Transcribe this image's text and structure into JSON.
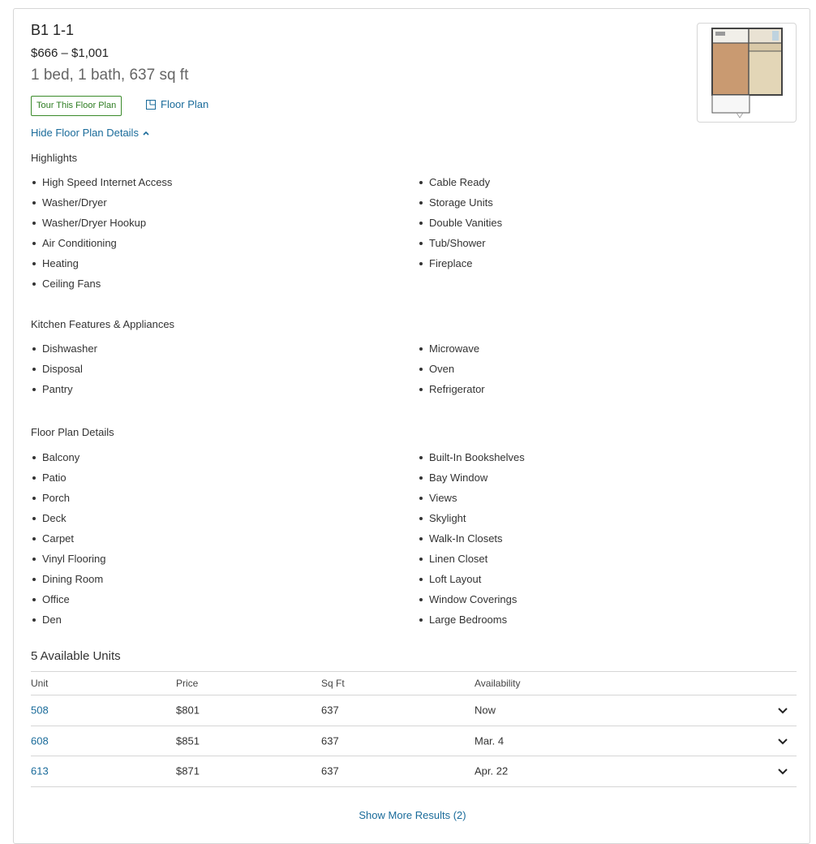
{
  "plan": {
    "name": "B1 1-1",
    "price_range": "$666 – $1,001",
    "bed_info": "1 bed, 1 bath, 637 sq ft",
    "tour_label": "Tour This Floor Plan",
    "floor_plan_label": "Floor Plan",
    "hide_details_label": "Hide Floor Plan Details"
  },
  "sections": {
    "highlights": {
      "title": "Highlights",
      "left": [
        "High Speed Internet Access",
        "Washer/Dryer",
        "Washer/Dryer Hookup",
        "Air Conditioning",
        "Heating",
        "Ceiling Fans"
      ],
      "right": [
        "Cable Ready",
        "Storage Units",
        "Double Vanities",
        "Tub/Shower",
        "Fireplace"
      ]
    },
    "kitchen": {
      "title": "Kitchen Features & Appliances",
      "left": [
        "Dishwasher",
        "Disposal",
        "Pantry"
      ],
      "right": [
        "Microwave",
        "Oven",
        "Refrigerator"
      ]
    },
    "floorplan": {
      "title": "Floor Plan Details",
      "left": [
        "Balcony",
        "Patio",
        "Porch",
        "Deck",
        "Carpet",
        "Vinyl Flooring",
        "Dining Room",
        "Office",
        "Den"
      ],
      "right": [
        "Built-In Bookshelves",
        "Bay Window",
        "Views",
        "Skylight",
        "Walk-In Closets",
        "Linen Closet",
        "Loft Layout",
        "Window Coverings",
        "Large Bedrooms"
      ]
    }
  },
  "units": {
    "title": "5 Available Units",
    "headers": [
      "Unit",
      "Price",
      "Sq Ft",
      "Availability"
    ],
    "rows": [
      {
        "unit": "508",
        "price": "$801",
        "sqft": "637",
        "availability": "Now"
      },
      {
        "unit": "608",
        "price": "$851",
        "sqft": "637",
        "availability": "Mar. 4"
      },
      {
        "unit": "613",
        "price": "$871",
        "sqft": "637",
        "availability": "Apr. 22"
      }
    ],
    "show_more_label": "Show More Results (2)"
  },
  "colors": {
    "link": "#1a6b9a",
    "tour_green": "#2e7d22",
    "border": "#d6d6d6"
  },
  "icons": {
    "floor_plan": "floor-plan-icon",
    "chevron_up": "chevron-up-icon",
    "chevron_down": "chevron-down-icon"
  }
}
